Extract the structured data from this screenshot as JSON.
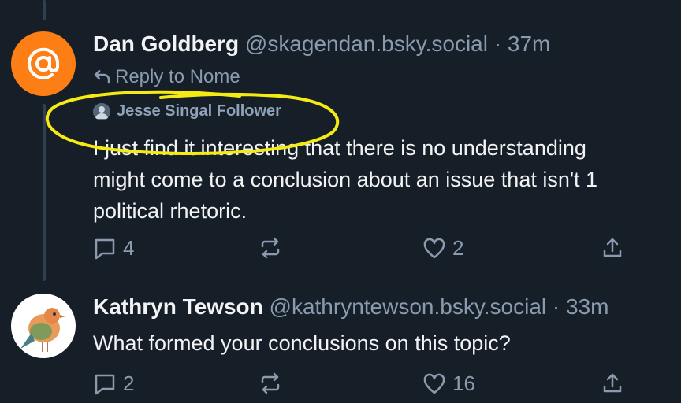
{
  "posts": [
    {
      "author_name": "Dan Goldberg",
      "handle": "@skagendan.bsky.social",
      "time": "· 37m",
      "reply_to": "Reply to Nome",
      "label": "Jesse Singal Follower",
      "text_lines": [
        "I just find it interesting that there is no understanding",
        "might come to a conclusion about an issue that isn't 1",
        "political rhetoric."
      ],
      "reply_count": "4",
      "like_count": "2",
      "avatar_icon": "at-sign-icon"
    },
    {
      "author_name": "Kathryn Tewson",
      "handle": "@kathryntewson.bsky.social",
      "time": "· 33m",
      "text_lines": [
        "What formed your conclusions on this topic?"
      ],
      "reply_count": "2",
      "like_count": "16",
      "avatar_icon": "bird-icon"
    }
  ],
  "colors": {
    "background": "#161e27",
    "muted": "#8a9bb0",
    "avatar_orange": "#fd7e14",
    "highlight": "#f5ea14"
  }
}
